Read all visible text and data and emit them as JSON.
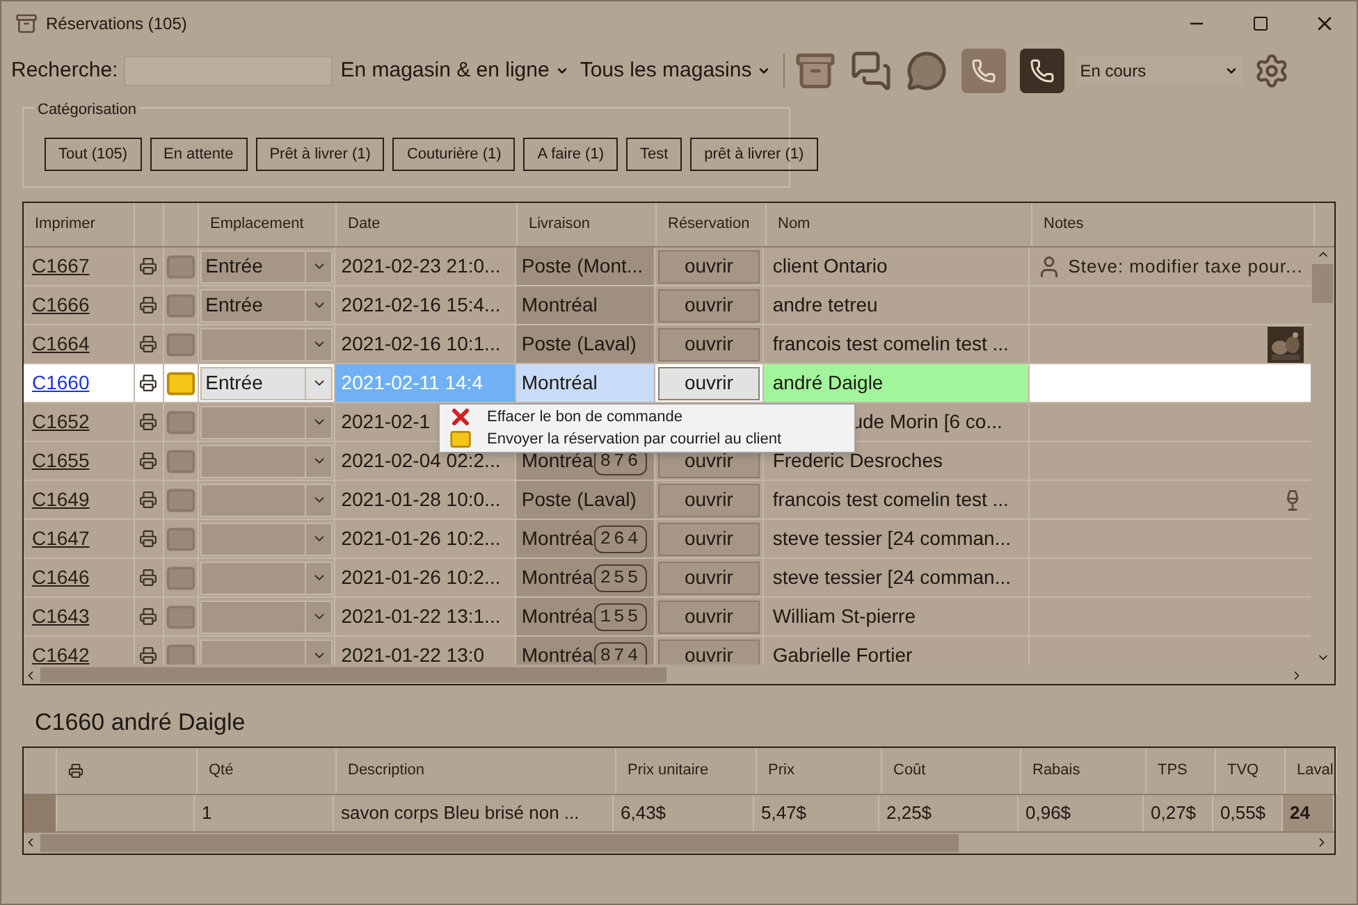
{
  "window": {
    "title": "Réservations (105)"
  },
  "toolbar": {
    "search_label": "Recherche:",
    "channel_menu": "En magasin & en ligne",
    "store_menu": "Tous les magasins",
    "status_select": "En cours",
    "phone_buttons": [
      {
        "selected": false
      },
      {
        "selected": true
      }
    ]
  },
  "categorisation": {
    "title": "Catégorisation",
    "buttons": [
      "Tout (105)",
      "En attente",
      "Prêt à livrer (1)",
      "Couturière (1)",
      "A faire (1)",
      "Test",
      "prêt à livrer (1)"
    ]
  },
  "table": {
    "columns": [
      "Imprimer",
      "Emplacement",
      "Date",
      "Livraison",
      "Réservation",
      "Nom",
      "Notes"
    ],
    "rows": [
      {
        "id": "C1667",
        "selected": false,
        "location": "Entrée",
        "date": "2021-02-23 21:0...",
        "delivery": "Poste (Mont...",
        "button": "ouvrir",
        "name": "client  Ontario",
        "note": {
          "kind": "person",
          "text": "Steve: modifier taxe pour..."
        }
      },
      {
        "id": "C1666",
        "selected": false,
        "location": "Entrée",
        "date": "2021-02-16 15:4...",
        "delivery": "Montréal",
        "button": "ouvrir",
        "name": "andre tetreu"
      },
      {
        "id": "C1664",
        "selected": false,
        "date": "2021-02-16 10:1...",
        "delivery": "Poste (Laval)",
        "button": "ouvrir",
        "name": "francois test comelin test ..."
      },
      {
        "id": "C1660",
        "selected": true,
        "location": "Entrée",
        "date": "2021-02-11 14:4",
        "delivery": "Montréal",
        "button": "ouvrir",
        "name": "andré Daigle"
      },
      {
        "id": "C1652",
        "selected": false,
        "date": "2021-02-1",
        "name": "ude Morin [6 co..."
      },
      {
        "id": "C1655",
        "selected": false,
        "date": "2021-02-04 02:2...",
        "delivery": "Montréa",
        "badge": "876",
        "button": "ouvrir",
        "name": "Frederic Desroches"
      },
      {
        "id": "C1649",
        "selected": false,
        "date": "2021-01-28 10:0...",
        "delivery": "Poste (Laval)",
        "button": "ouvrir",
        "name": "francois test comelin test ...",
        "note": {
          "kind": "bottle"
        }
      },
      {
        "id": "C1647",
        "selected": false,
        "date": "2021-01-26 10:2...",
        "delivery": "Montréa",
        "badge": "264",
        "button": "ouvrir",
        "name": "steve tessier [24 comman..."
      },
      {
        "id": "C1646",
        "selected": false,
        "date": "2021-01-26 10:2...",
        "delivery": "Montréa",
        "badge": "255",
        "button": "ouvrir",
        "name": "steve tessier [24 comman..."
      },
      {
        "id": "C1643",
        "selected": false,
        "date": "2021-01-22 13:1...",
        "delivery": "Montréa",
        "badge": "155",
        "button": "ouvrir",
        "name": "William St-pierre"
      },
      {
        "id": "C1642",
        "selected": false,
        "date": "2021-01-22 13:0",
        "delivery": "Montréa",
        "badge": "874",
        "button": "ouvrir",
        "name": "Gabrielle Fortier"
      }
    ]
  },
  "context_menu": [
    {
      "kind": "delete",
      "label": "Effacer le bon de commande"
    },
    {
      "kind": "mail",
      "label": "Envoyer la réservation par courriel au client"
    }
  ],
  "detail": {
    "title": "C1660 andré Daigle",
    "columns": [
      "Qté",
      "Description",
      "Prix unitaire",
      "Prix",
      "Coût",
      "Rabais",
      "TPS",
      "TVQ",
      "Laval"
    ],
    "rows": [
      {
        "cells": [
          "1",
          "savon corps Bleu    brisé non ...",
          "6,43$",
          "5,47$",
          "2,25$",
          "0,96$",
          "0,27$",
          "0,55$",
          "24"
        ]
      }
    ]
  }
}
